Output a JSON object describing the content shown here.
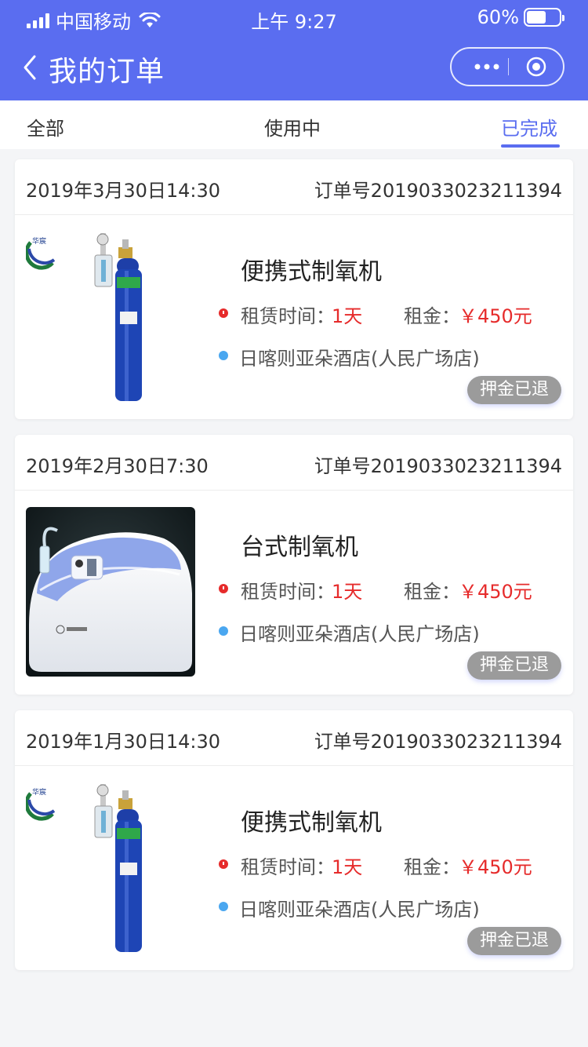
{
  "status_bar": {
    "carrier": "中国移动",
    "time": "上午 9:27",
    "battery": "60%",
    "battery_level": 0.6
  },
  "nav": {
    "title": "我的订单"
  },
  "tabs": [
    {
      "label": "全部"
    },
    {
      "label": "使用中"
    },
    {
      "label": "已完成",
      "active": true
    }
  ],
  "orders": [
    {
      "date": "2019年3月30日14:30",
      "order_no": "订单号2019033023211394",
      "product": "便携式制氧机",
      "product_image": "oxygen-cylinder",
      "rent_label": "租赁时间：",
      "rent_value": "1天",
      "deposit_label": "租金：",
      "deposit_value": "￥450元",
      "store": "日喀则亚朵酒店(人民广场店)",
      "status": "押金已退",
      "logo_text": "华宸"
    },
    {
      "date": "2019年2月30日7:30",
      "order_no": "订单号2019033023211394",
      "product": "台式制氧机",
      "product_image": "desktop-oxygen-concentrator",
      "rent_label": "租赁时间：",
      "rent_value": "1天",
      "deposit_label": "租金：",
      "deposit_value": "￥450元",
      "store": "日喀则亚朵酒店(人民广场店)",
      "status": "押金已退"
    },
    {
      "date": "2019年1月30日14:30",
      "order_no": "订单号2019033023211394",
      "product": "便携式制氧机",
      "product_image": "oxygen-cylinder",
      "rent_label": "租赁时间：",
      "rent_value": "1天",
      "deposit_label": "租金：",
      "deposit_value": "￥450元",
      "store": "日喀则亚朵酒店(人民广场店)",
      "status": "押金已退",
      "logo_text": "华宸"
    }
  ],
  "colors": {
    "primary": "#5a6df0",
    "price_red": "#e62b2b",
    "store_dot": "#4aa7f0",
    "pill_gray": "#9b9b9b"
  }
}
